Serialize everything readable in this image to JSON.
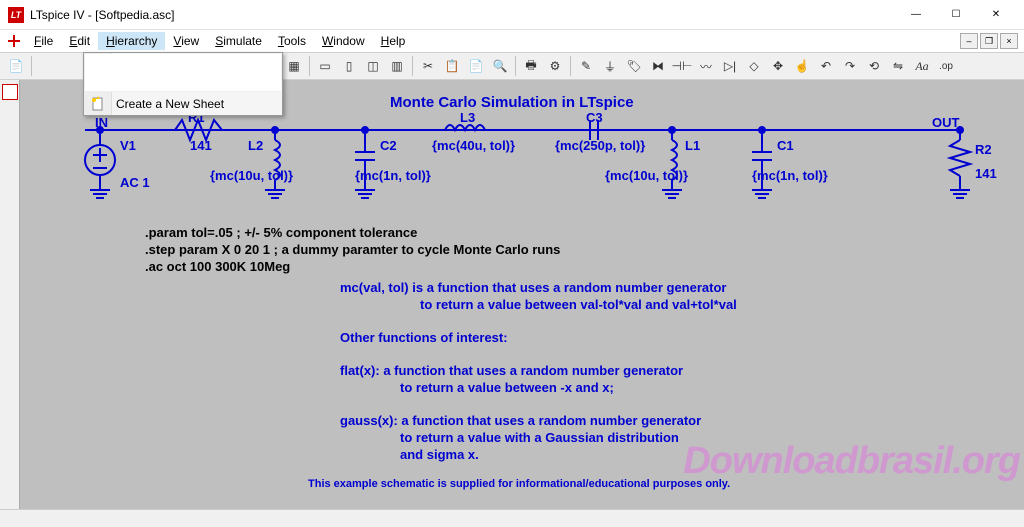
{
  "window": {
    "title": "LTspice IV - [Softpedia.asc]",
    "min": "—",
    "max": "☐",
    "close": "✕"
  },
  "menu": {
    "file": "File",
    "edit": "Edit",
    "hierarchy": "Hierarchy",
    "view": "View",
    "simulate": "Simulate",
    "tools": "Tools",
    "window": "Window",
    "help": "Help"
  },
  "dropdown": {
    "create_sheet": "Create a New Sheet"
  },
  "schematic": {
    "title": "Monte Carlo Simulation in LTspice",
    "in": "IN",
    "out": "OUT",
    "v1": "V1",
    "v1_val": "AC 1",
    "r1": "R1",
    "r1_val": "141",
    "l2": "L2",
    "l2_val": "{mc(10u, tol)}",
    "c2": "C2",
    "c2_val": "{mc(1n, tol)}",
    "l3": "L3",
    "l3_val": "{mc(40u, tol)}",
    "c3": "C3",
    "c3_val": "{mc(250p, tol)}",
    "l1": "L1",
    "l1_val": "{mc(10u, tol)}",
    "c1": "C1",
    "c1_val": "{mc(1n, tol)}",
    "r2": "R2",
    "r2_val": "141"
  },
  "directives": {
    "param": ".param tol=.05 ; +/- 5% component tolerance",
    "step": ".step param X 0 20 1 ; a dummy paramter to cycle Monte Carlo runs",
    "ac": ".ac oct 100 300K 10Meg"
  },
  "notes": {
    "mc1": "mc(val, tol) is a function that uses a random number generator",
    "mc2": "to return a value between val-tol*val and val+tol*val",
    "other": "Other functions of interest:",
    "flat1": "flat(x): a function that uses a random number generator",
    "flat2": "to return a value between -x and x;",
    "gauss1": "gauss(x): a function that uses a random number generator",
    "gauss2": "to return a value with a Gaussian distribution",
    "gauss3": "and sigma x.",
    "footer": "This example schematic is supplied for informational/educational purposes only."
  },
  "watermark": "Downloadbrasil.org"
}
